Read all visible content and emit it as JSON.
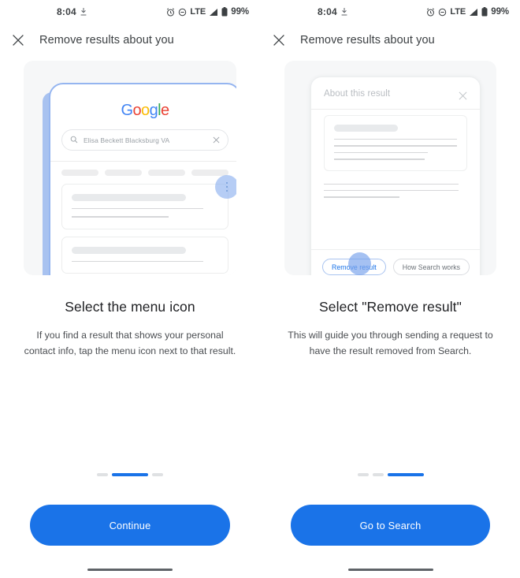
{
  "screens": [
    {
      "status_bar": {
        "time": "8:04",
        "left_icons": [
          "download-icon"
        ],
        "network": "LTE",
        "battery_percent": "99%",
        "right_icons": [
          "alarm-icon",
          "do-not-disturb-icon",
          "signal-icon",
          "battery-icon"
        ]
      },
      "app_bar": {
        "close_icon": "close-icon",
        "title": "Remove results about you"
      },
      "illustration": {
        "type": "google-search-results-phone",
        "logo": {
          "letters": [
            "G",
            "o",
            "o",
            "g",
            "l",
            "e"
          ],
          "colors": [
            "#4285f4",
            "#ea4335",
            "#fbbc05",
            "#4285f4",
            "#34a853",
            "#ea4335"
          ]
        },
        "search_query": "Elisa Beckett Blacksburg VA",
        "search_icon": "search-icon",
        "clear_icon": "clear-icon",
        "filter_chip_count": 4,
        "menu_icon": "three-dot-menu-icon",
        "highlight_color": "#8ab0f0"
      },
      "heading": "Select the menu icon",
      "body": "If you find a result that shows your personal contact info, tap the menu icon next to that result.",
      "indicators": {
        "count": 3,
        "active_index": 1
      },
      "cta_label": "Continue",
      "cta_color": "#1a73e8"
    },
    {
      "status_bar": {
        "time": "8:04",
        "left_icons": [
          "download-icon"
        ],
        "network": "LTE",
        "battery_percent": "99%",
        "right_icons": [
          "alarm-icon",
          "do-not-disturb-icon",
          "signal-icon",
          "battery-icon"
        ]
      },
      "app_bar": {
        "close_icon": "close-icon",
        "title": "Remove results about you"
      },
      "illustration": {
        "type": "about-this-result-sheet",
        "sheet_title": "About this result",
        "sheet_close_icon": "close-icon",
        "primary_pill": "Remove result",
        "secondary_pill": "How Search works",
        "highlight_color": "#7ba4ec"
      },
      "heading": "Select \"Remove result\"",
      "body": "This will guide you through sending a request to have the result removed from Search.",
      "indicators": {
        "count": 3,
        "active_index": 2
      },
      "cta_label": "Go to Search",
      "cta_color": "#1a73e8"
    }
  ]
}
